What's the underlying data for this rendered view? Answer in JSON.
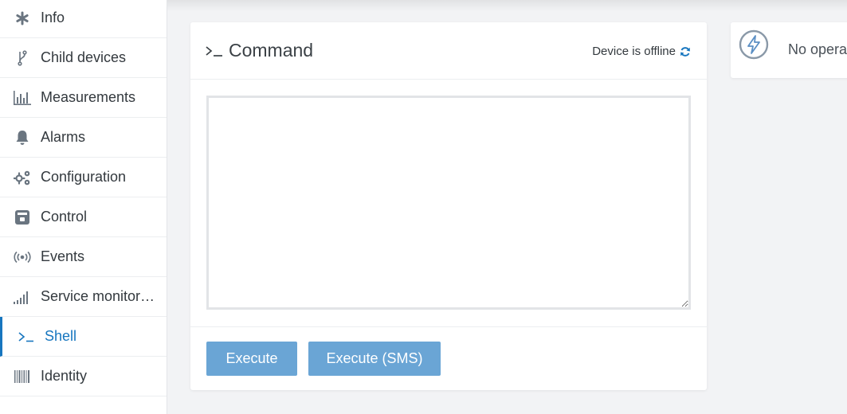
{
  "sidebar": {
    "items": [
      {
        "label": "Info",
        "icon": "asterisk-icon"
      },
      {
        "label": "Child devices",
        "icon": "branch-icon"
      },
      {
        "label": "Measurements",
        "icon": "bar-chart-icon"
      },
      {
        "label": "Alarms",
        "icon": "bell-icon"
      },
      {
        "label": "Configuration",
        "icon": "gears-icon"
      },
      {
        "label": "Control",
        "icon": "control-box-icon"
      },
      {
        "label": "Events",
        "icon": "broadcast-icon"
      },
      {
        "label": "Service monitori…",
        "icon": "signal-bars-icon"
      },
      {
        "label": "Shell",
        "icon": "terminal-icon",
        "active": true
      },
      {
        "label": "Identity",
        "icon": "barcode-icon"
      }
    ]
  },
  "command_panel": {
    "title": "Command",
    "status": "Device is offline",
    "textarea_value": "",
    "execute_label": "Execute",
    "execute_sms_label": "Execute (SMS)"
  },
  "operations_panel": {
    "text": "No operat"
  },
  "colors": {
    "accent": "#1776bf",
    "button": "#6aa5d5",
    "background": "#f2f3f5"
  }
}
